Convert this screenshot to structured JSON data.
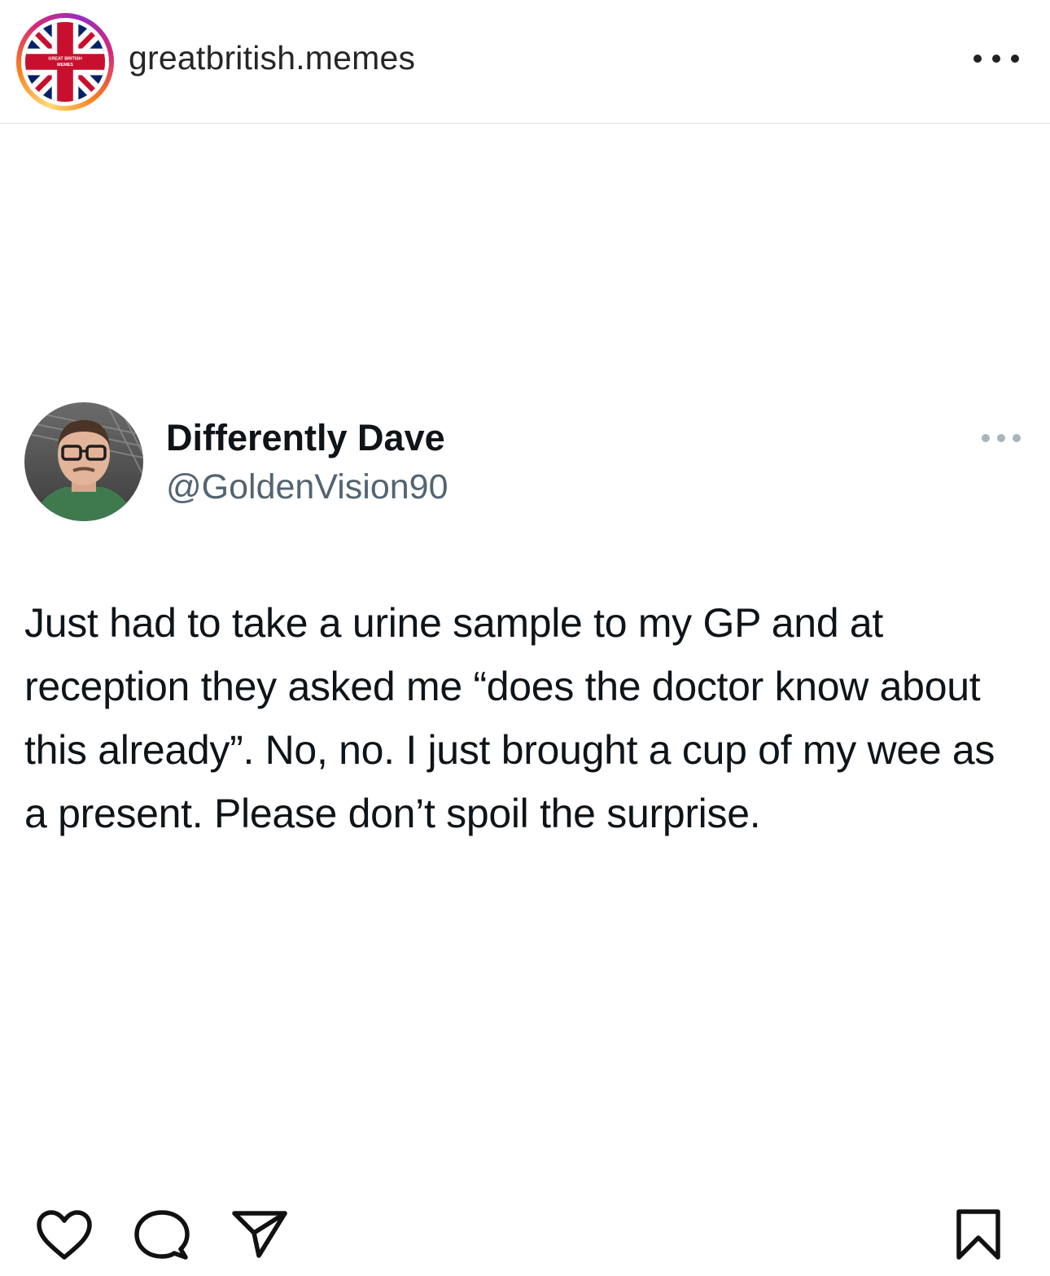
{
  "post": {
    "author_username": "greatbritish.memes",
    "avatar_text": "GREAT BRITISH MEMES",
    "icons": {
      "more": "more-horizontal-icon",
      "like": "heart-icon",
      "comment": "comment-bubble-icon",
      "share": "paper-plane-icon",
      "save": "bookmark-icon"
    }
  },
  "tweet": {
    "display_name": "Differently Dave",
    "handle": "@GoldenVision90",
    "text": "Just had to take a urine sample to my GP and at reception they asked me “does the doctor know about this already”. No, no. I just brought a cup of my wee as a present. Please don’t spoil the surprise."
  },
  "colors": {
    "ring_gradient": [
      "#feda75",
      "#fa7e1e",
      "#d62976",
      "#962fbf"
    ],
    "flag_red": "#c8102e",
    "flag_blue": "#012169",
    "handle_gray": "#536471"
  }
}
